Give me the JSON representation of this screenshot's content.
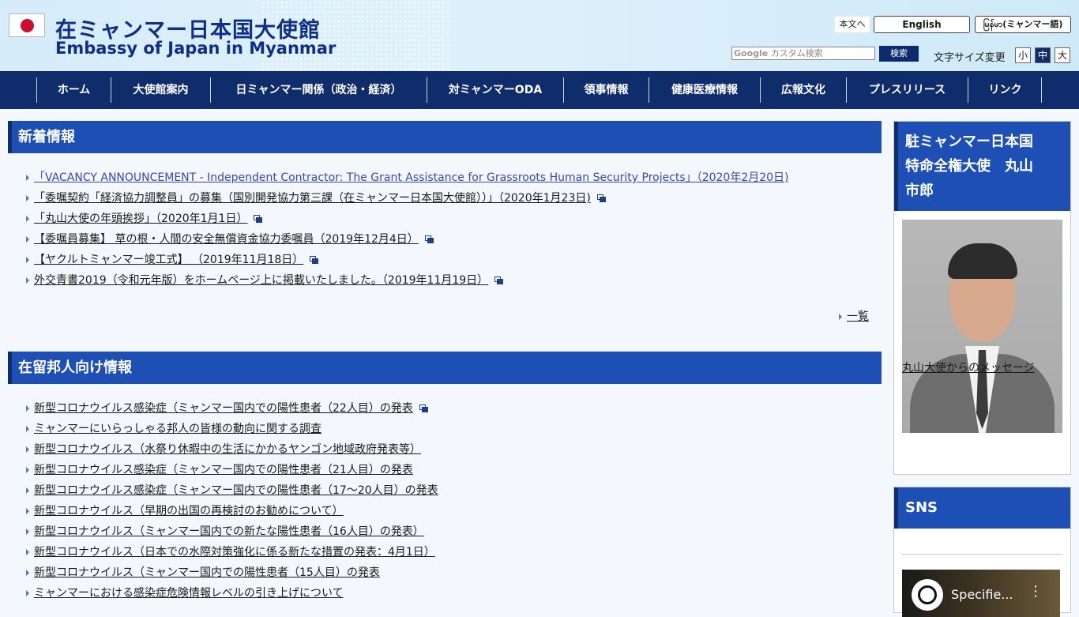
{
  "header": {
    "title_ja": "在ミャンマー日本国大使館",
    "title_en": "Embassy of Japan in Myanmar",
    "skip_link": "本文へ",
    "lang_english": "English",
    "lang_myanmar": "မြန်မာ(ミャンマー語)",
    "search_brand": "Google",
    "search_placeholder": "カスタム検索",
    "search_button": "検索",
    "font_size_label": "文字サイズ変更",
    "font_sizes": [
      "小",
      "中",
      "大"
    ]
  },
  "nav": [
    "ホーム",
    "大使館案内",
    "日ミャンマー関係（政治・経済）",
    "対ミャンマーODA",
    "領事情報",
    "健康医療情報",
    "広報文化",
    "プレスリリース",
    "リンク"
  ],
  "news": {
    "heading": "新着情報",
    "items": [
      "「VACANCY ANNOUNCEMENT - Independent Contractor: The Grant Assistance for Grassroots Human Security Projects」（2020年2月20日)",
      "「委嘱契約「経済協力調整員」の募集（国別開発協力第三課（在ミャンマー日本国大使館））」（2020年1月23日)",
      "「丸山大使の年頭挨拶」（2020年1月1日）",
      "【委嘱員募集】 草の根・人間の安全無償資金協力委嘱員（2019年12月4日）",
      "【ヤクルトミャンマー竣工式】 （2019年11月18日）",
      "外交青書2019（令和元年版）をホームページ上に掲載いたしました。（2019年11月19日）"
    ],
    "more": "一覧"
  },
  "residents": {
    "heading": "在留邦人向け情報",
    "items": [
      "新型コロナウイルス感染症（ミャンマー国内での陽性患者（22人目）の発表",
      "ミャンマーにいらっしゃる邦人の皆様の動向に関する調査",
      "新型コロナウイルス（水祭り休暇中の生活にかかるヤンゴン地域政府発表等）",
      "新型コロナウイルス感染症（ミャンマー国内での陽性患者（21人目）の発表",
      "新型コロナウイルス感染症（ミャンマー国内での陽性患者（17～20人目）の発表",
      "新型コロナウイルス（早期の出国の再検討のお勧めについて）",
      "新型コロナウイルス（ミャンマー国内での新たな陽性患者（16人目）の発表）",
      "新型コロナウイルス（日本での水際対策強化に係る新たな措置の発表：4月1日）",
      "新型コロナウイルス（ミャンマー国内での陽性患者（15人目）の発表",
      "ミャンマーにおける感染症危険情報レベルの引き上げについて"
    ]
  },
  "ambassador": {
    "heading_lines": [
      "駐ミャンマー日本国",
      "特命全権大使　丸山",
      "市郎"
    ],
    "message_link": "丸山大使からのメッセージ"
  },
  "sns": {
    "heading": "SNS",
    "video_title": "Specifie..."
  }
}
